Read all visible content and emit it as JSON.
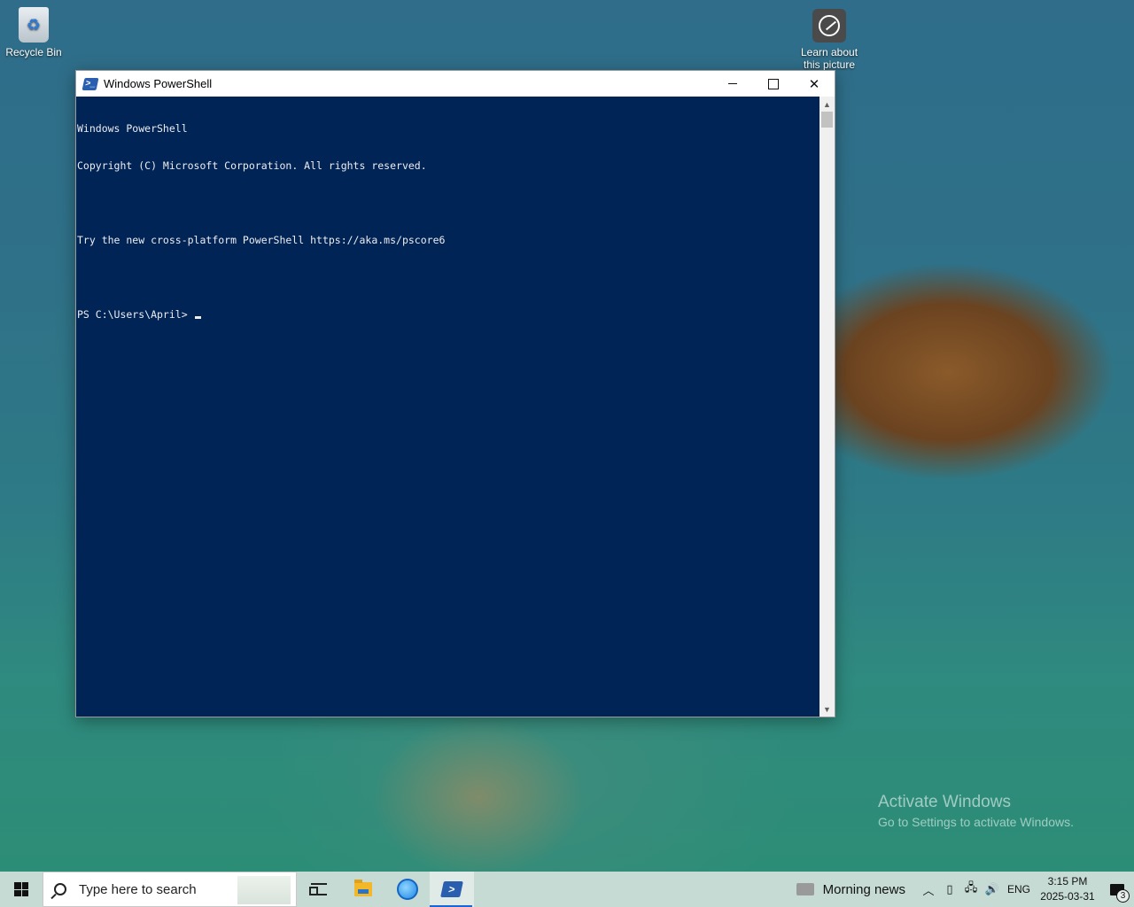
{
  "desktop": {
    "icons": [
      {
        "label": "Recycle Bin"
      },
      {
        "label": "Learn about this picture"
      }
    ],
    "watermark": {
      "title": "Activate Windows",
      "subtitle": "Go to Settings to activate Windows."
    }
  },
  "window": {
    "title": "Windows PowerShell",
    "console_lines": [
      "Windows PowerShell",
      "Copyright (C) Microsoft Corporation. All rights reserved.",
      "",
      "Try the new cross-platform PowerShell https://aka.ms/pscore6",
      ""
    ],
    "prompt": "PS C:\\Users\\April> "
  },
  "taskbar": {
    "search_placeholder": "Type here to search",
    "news": "Morning news",
    "language": "ENG",
    "time": "3:15 PM",
    "date": "2025-03-31",
    "notification_count": "3"
  }
}
